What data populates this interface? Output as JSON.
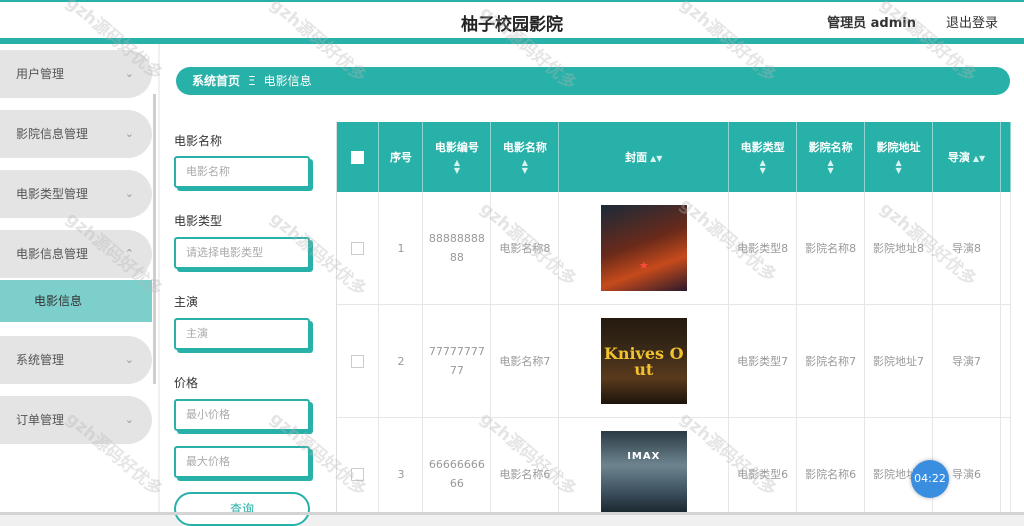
{
  "header": {
    "title": "柚子校园影院",
    "user": "管理员 admin",
    "logout": "退出登录"
  },
  "sidebar": {
    "items": [
      {
        "label": "用户管理",
        "chevron": "chevron-down-icon"
      },
      {
        "label": "影院信息管理",
        "chevron": "chevron-down-icon"
      },
      {
        "label": "电影类型管理",
        "chevron": "chevron-down-icon"
      },
      {
        "label": "电影信息管理",
        "chevron": "chevron-up-icon"
      },
      {
        "label": "系统管理",
        "chevron": "chevron-down-icon"
      },
      {
        "label": "订单管理",
        "chevron": "chevron-down-icon"
      }
    ],
    "active_sub": "电影信息"
  },
  "breadcrumb": {
    "home": "系统首页",
    "separator": "Ξ",
    "current": "电影信息"
  },
  "search": {
    "name_label": "电影名称",
    "name_placeholder": "电影名称",
    "type_label": "电影类型",
    "type_placeholder": "请选择电影类型",
    "actor_label": "主演",
    "actor_placeholder": "主演",
    "price_label": "价格",
    "min_placeholder": "最小价格",
    "max_placeholder": "最大价格",
    "button": "查询"
  },
  "table": {
    "columns": [
      "序号",
      "电影编号",
      "电影名称",
      "封面",
      "电影类型",
      "影院名称",
      "影院地址",
      "导演"
    ],
    "rows": [
      {
        "index": "1",
        "code": "8888888888",
        "name": "电影名称8",
        "poster": "poster-1",
        "type": "电影类型8",
        "cinema": "影院名称8",
        "address": "影院地址8",
        "director": "导演8"
      },
      {
        "index": "2",
        "code": "7777777777",
        "name": "电影名称7",
        "poster": "poster-2",
        "type": "电影类型7",
        "cinema": "影院名称7",
        "address": "影院地址7",
        "director": "导演7"
      },
      {
        "index": "3",
        "code": "6666666666",
        "name": "电影名称6",
        "poster": "poster-3",
        "type": "电影类型6",
        "cinema": "影院名称6",
        "address": "影院地址6",
        "director": "导演6"
      }
    ]
  },
  "posters": {
    "p2_title": "Knives Out",
    "p3_brand": "IMAX"
  },
  "timer": "04:22",
  "watermark": "gzh源码好优多",
  "colors": {
    "accent": "#28b1a8",
    "menu_bg": "#e4e4e4",
    "active_sub_bg": "#7ccfca",
    "timer": "#3a8ee0"
  }
}
